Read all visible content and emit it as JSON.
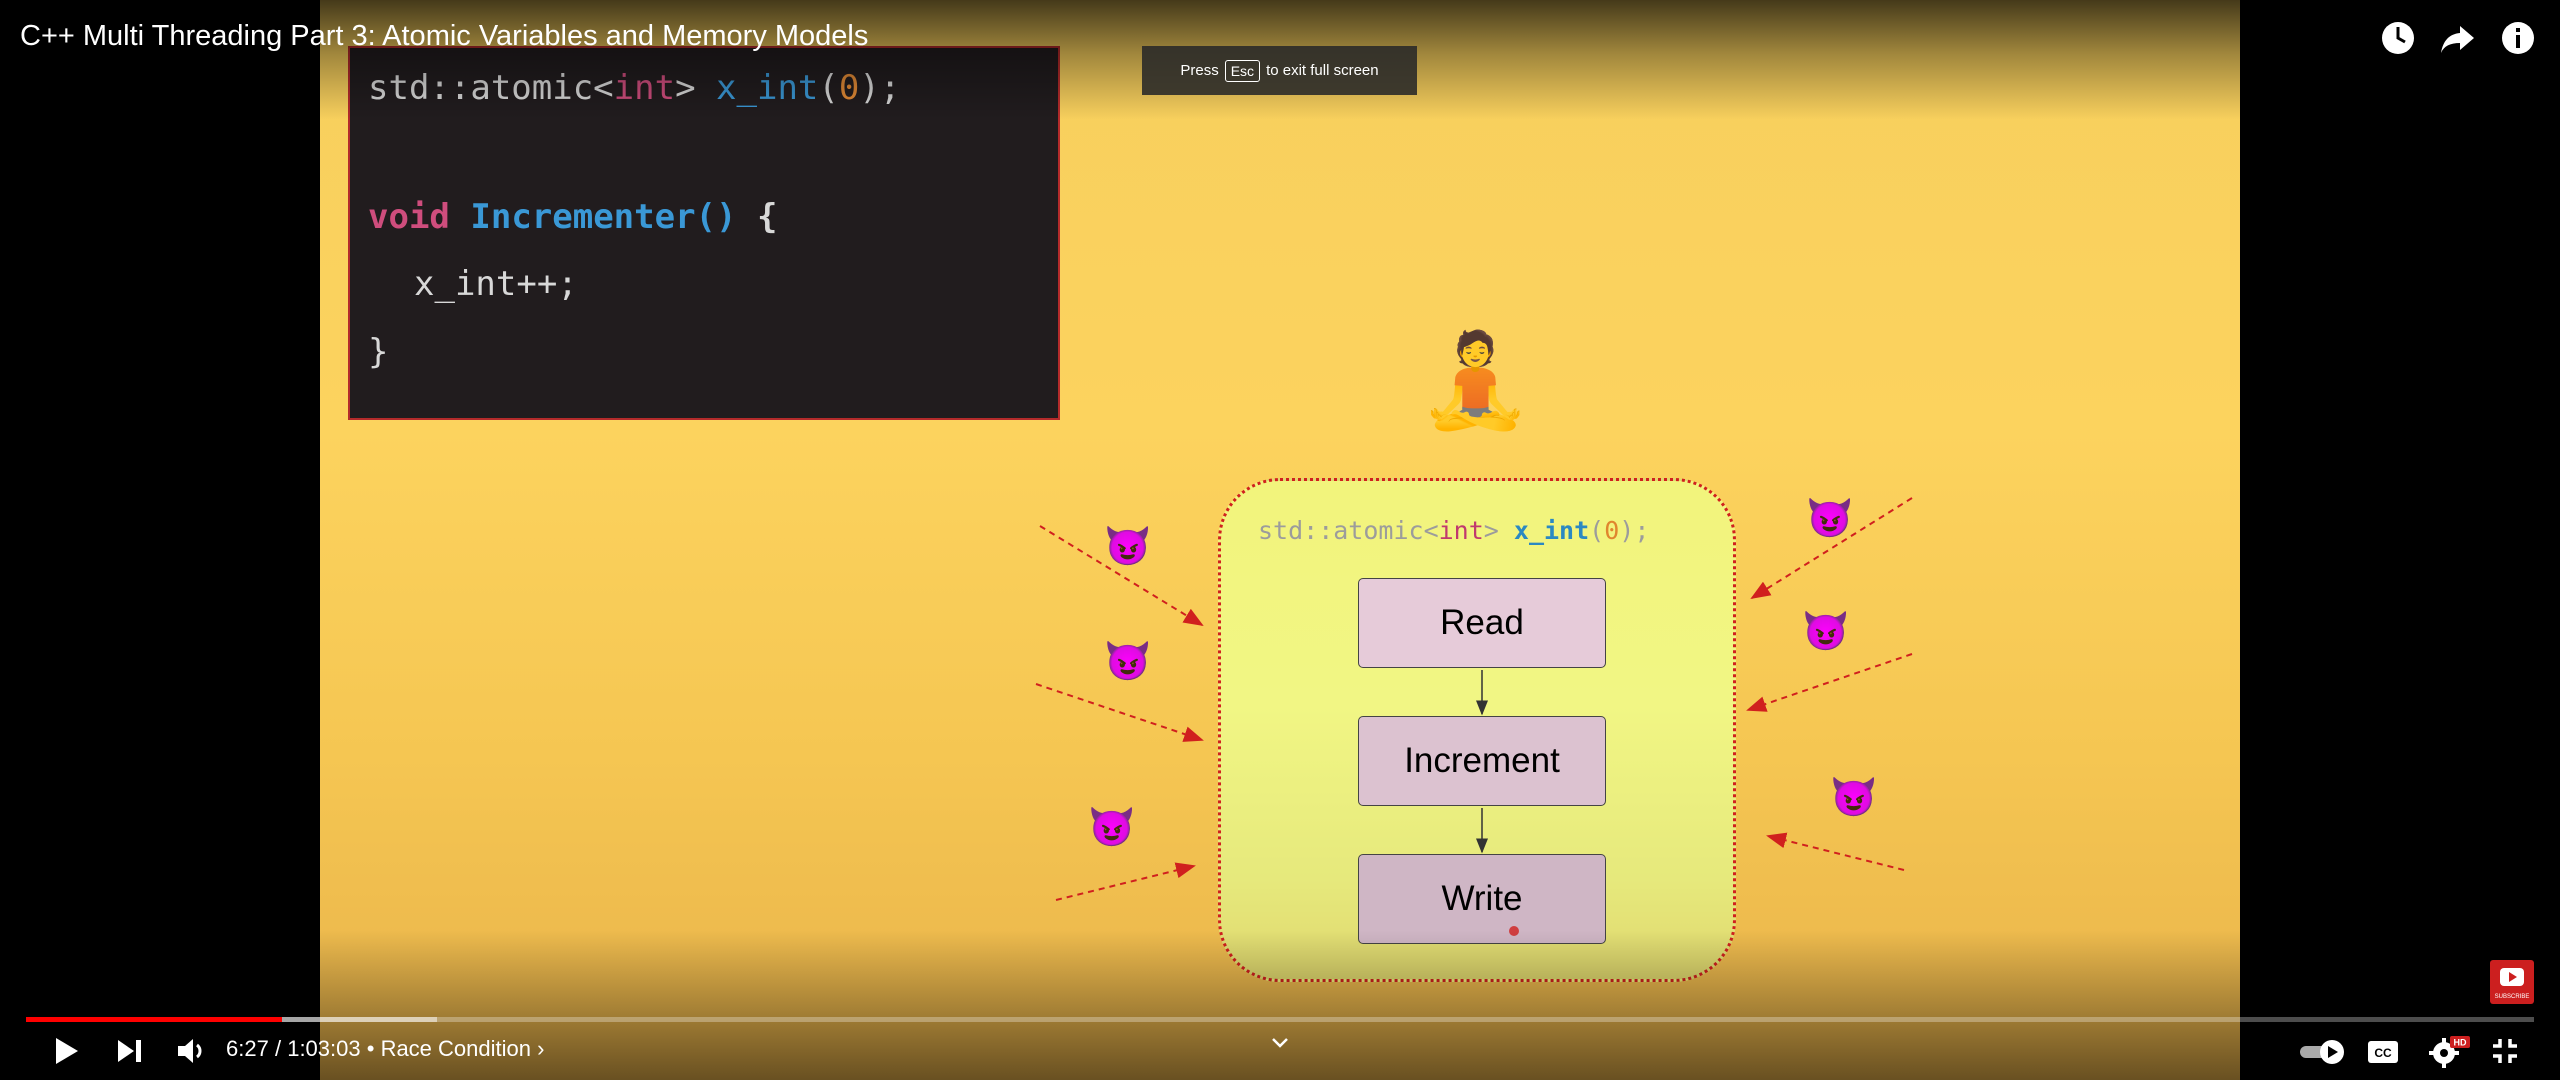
{
  "video": {
    "title": "C++ Multi Threading Part 3: Atomic Variables and Memory Models"
  },
  "toast": {
    "prefix": "Press",
    "key": "Esc",
    "suffix": "to exit full screen"
  },
  "slide": {
    "code": {
      "line1": {
        "type": "std::atomic<",
        "template_arg": "int",
        "close": ">",
        "var": "x_int",
        "open_paren": "(",
        "init": "0",
        "end": ");"
      },
      "line2": {
        "kw": "void",
        "fn": "Incrementer()",
        "brace": "{"
      },
      "line3": "x_int++;",
      "line4": "}"
    },
    "diagram": {
      "atomic_decl": {
        "type": "std::atomic<",
        "template_arg": "int",
        "close": ">",
        "var": "x_int",
        "open_paren": "(",
        "init": "0",
        "end": ");"
      },
      "stages": [
        "Read",
        "Increment",
        "Write"
      ]
    },
    "emoji": {
      "meditator": "🧘",
      "devil": "😈"
    },
    "colors": {
      "code_bg": "#211c1e",
      "keyword": "#cf4d7d",
      "function": "#3a98d6",
      "number": "#e28a35",
      "atomic_border": "#d0201e",
      "arrow": "#d0201e"
    }
  },
  "player": {
    "time_current": "6:27",
    "time_separator": "/",
    "time_total": "1:03:03",
    "chapter_separator": "•",
    "chapter": "Race Condition",
    "chapter_chevron": "›",
    "progress_fraction": 0.102,
    "buffered_fraction": 0.062,
    "hd_badge": "HD",
    "icons": {
      "play": "play-icon",
      "next": "next-icon",
      "volume": "volume-icon",
      "autoplay": "autoplay-toggle-icon",
      "captions": "captions-icon",
      "settings": "settings-icon",
      "exit_fullscreen": "exit-fullscreen-icon",
      "watch_later": "clock-icon",
      "share": "share-icon",
      "info": "info-icon",
      "chevron": "chevron-down-icon"
    },
    "subscribe_label": "SUBSCRIBE"
  }
}
